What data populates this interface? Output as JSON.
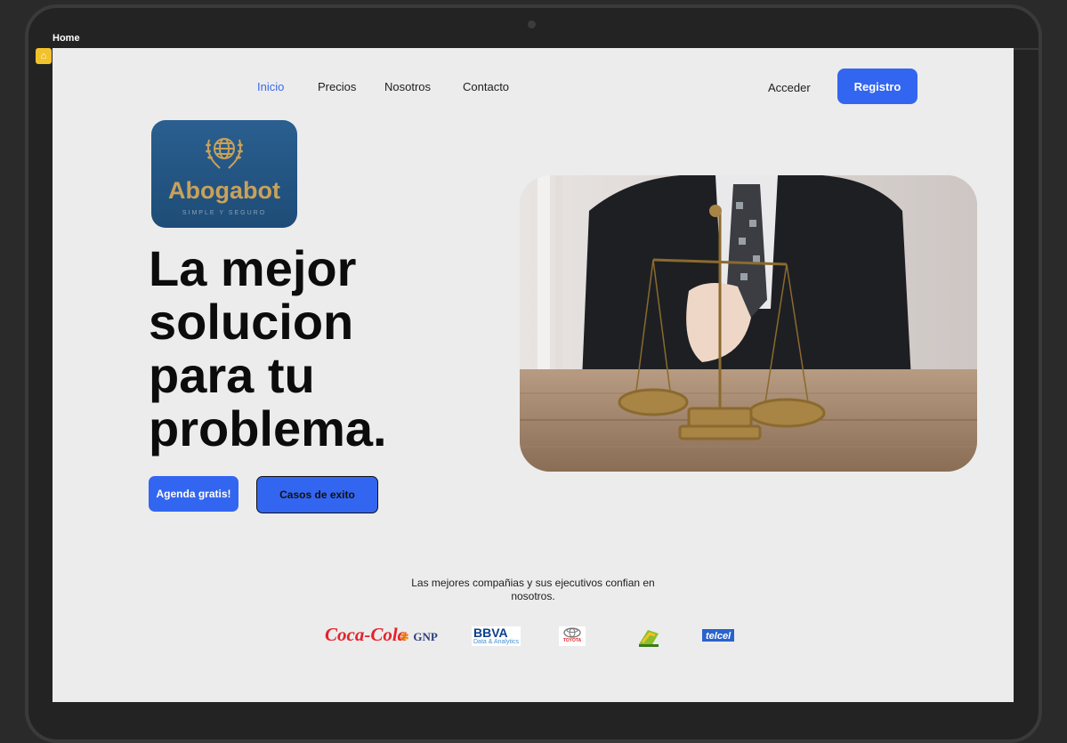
{
  "frame": {
    "label": "Home"
  },
  "nav": {
    "links": [
      "Inicio",
      "Precios",
      "Nosotros",
      "Contacto"
    ],
    "active": "Inicio",
    "login_label": "Acceder",
    "register_label": "Registro"
  },
  "logo": {
    "name": "Abogabot",
    "tagline": "SIMPLE Y SEGURO"
  },
  "hero": {
    "title": "La mejor solucion para tu problema.",
    "primary_cta": "Agenda gratis!",
    "secondary_cta": "Casos de exito"
  },
  "trust": {
    "tagline": "Las mejores compañias y sus ejecutivos confian en nosotros.",
    "brands": [
      {
        "name": "Coca-Cola",
        "text": "Coca-Cola"
      },
      {
        "name": "GNP",
        "text": "GNP"
      },
      {
        "name": "BBVA",
        "text": "BBVA",
        "subtext": "Data & Analytics"
      },
      {
        "name": "Toyota",
        "text": "TOYOTA"
      },
      {
        "name": "Multiva",
        "text": ""
      },
      {
        "name": "Telcel",
        "text": "telcel"
      }
    ]
  },
  "colors": {
    "accent": "#3366f0",
    "background": "#ececec",
    "dark": "#0c0c0c"
  }
}
